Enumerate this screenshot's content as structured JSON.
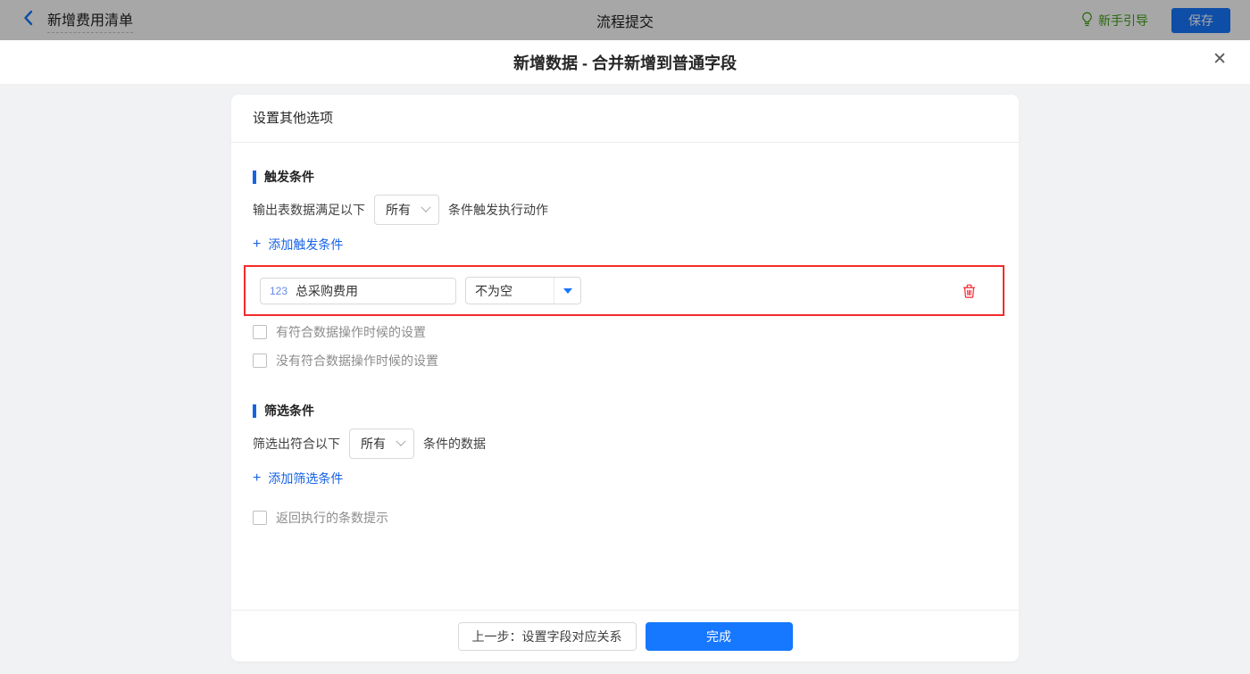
{
  "topbar": {
    "back_label": "新增费用清单",
    "center_title": "流程提交",
    "guide_label": "新手引导",
    "save_label": "保存"
  },
  "modal": {
    "title": "新增数据 - 合并新增到普通字段",
    "close_glyph": "✕"
  },
  "card": {
    "header": "设置其他选项",
    "trigger": {
      "section_title": "触发条件",
      "prefix": "输出表数据满足以下",
      "select_value": "所有",
      "suffix": "条件触发执行动作",
      "add_plus": "+",
      "add_label": "添加触发条件",
      "condition": {
        "field_type": "123",
        "field_name": "总采购费用",
        "operator": "不为空"
      },
      "checkboxes": [
        "有符合数据操作时候的设置",
        "没有符合数据操作时候的设置"
      ]
    },
    "filter": {
      "section_title": "筛选条件",
      "prefix": "筛选出符合以下",
      "select_value": "所有",
      "suffix": "条件的数据",
      "add_plus": "+",
      "add_label": "添加筛选条件",
      "checkbox": "返回执行的条数提示"
    },
    "footer": {
      "prev_label": "上一步：设置字段对应关系",
      "done_label": "完成"
    }
  },
  "colors": {
    "accent_blue": "#1677ff",
    "link_blue": "#1763e6",
    "danger_red": "#f5222d",
    "highlight_border": "#f52b2b",
    "guide_green": "#52c41a"
  }
}
